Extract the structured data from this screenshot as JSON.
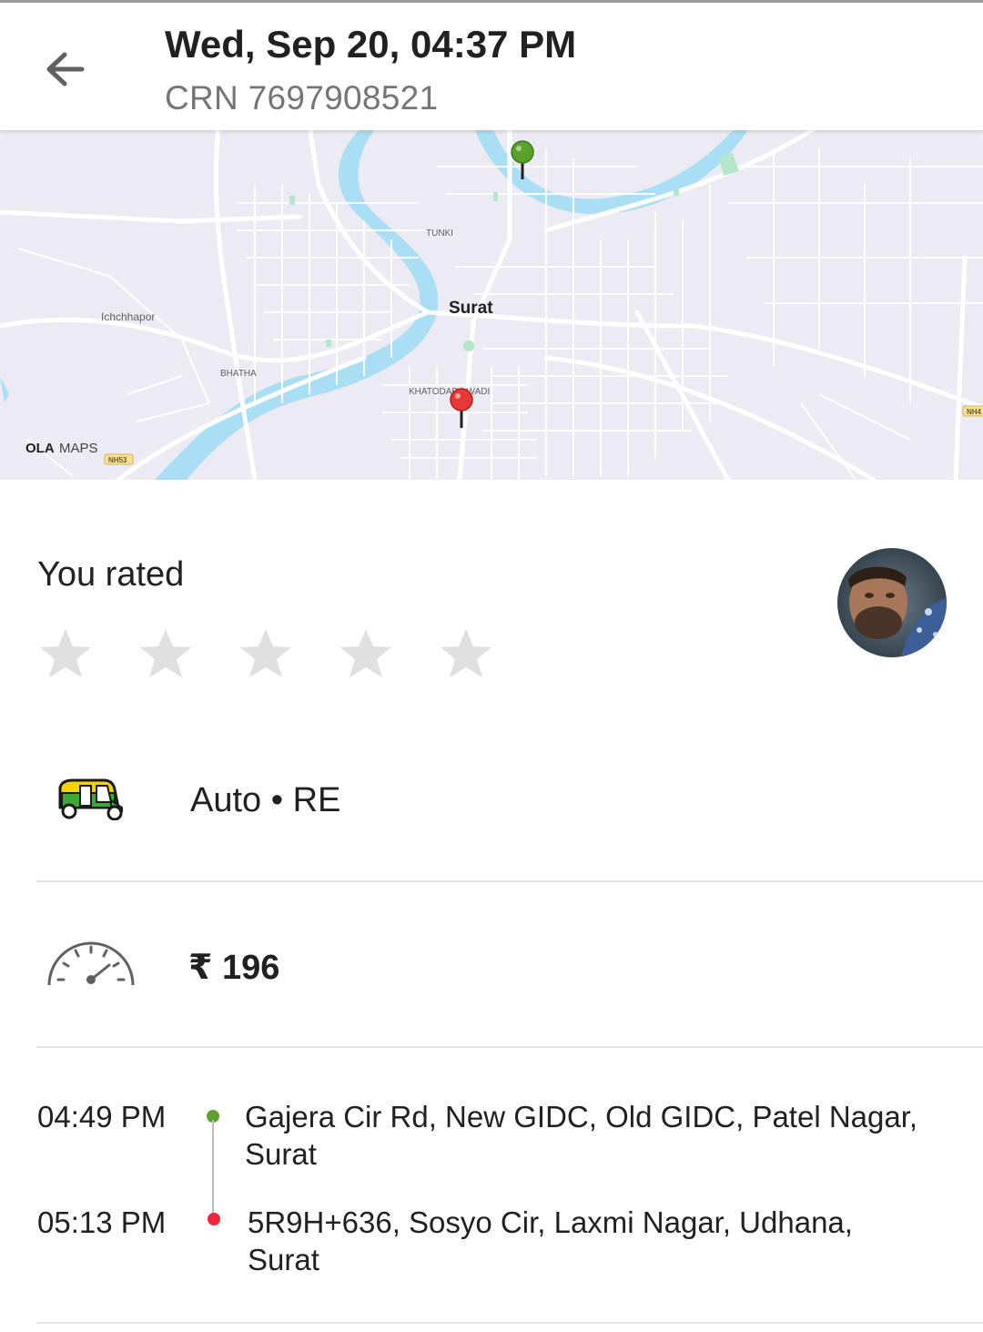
{
  "header": {
    "title": "Wed, Sep 20, 04:37 PM",
    "crn": "CRN 7697908521"
  },
  "map": {
    "city_label": "Surat",
    "area_labels": [
      "TUNKI",
      "Ichchhapor",
      "BHATHA",
      "KHATODARA WADI"
    ],
    "highway_labels": [
      "NH53",
      "NH4"
    ],
    "brand_ola": "OLA",
    "brand_maps": "MAPS",
    "pickup_pin_color": "#5aa12d",
    "drop_pin_color": "#e53935",
    "river_color": "#a9def5"
  },
  "rating": {
    "label": "You rated",
    "stars_total": 5,
    "stars_filled": 0,
    "star_color": "#e0e0e0"
  },
  "vehicle": {
    "icon": "auto-rickshaw-icon",
    "label": "Auto • RE"
  },
  "fare": {
    "icon": "speedometer-icon",
    "label": "₹ 196"
  },
  "trip": {
    "pickup": {
      "time": "04:49 PM",
      "address": "Gajera Cir Rd, New GIDC, Old GIDC, Patel Nagar, Surat",
      "color": "#5aa12d"
    },
    "drop": {
      "time": "05:13 PM",
      "address": "5R9H+636, Sosyo Cir, Laxmi Nagar, Udhana, Surat",
      "color": "#f0263a"
    }
  }
}
